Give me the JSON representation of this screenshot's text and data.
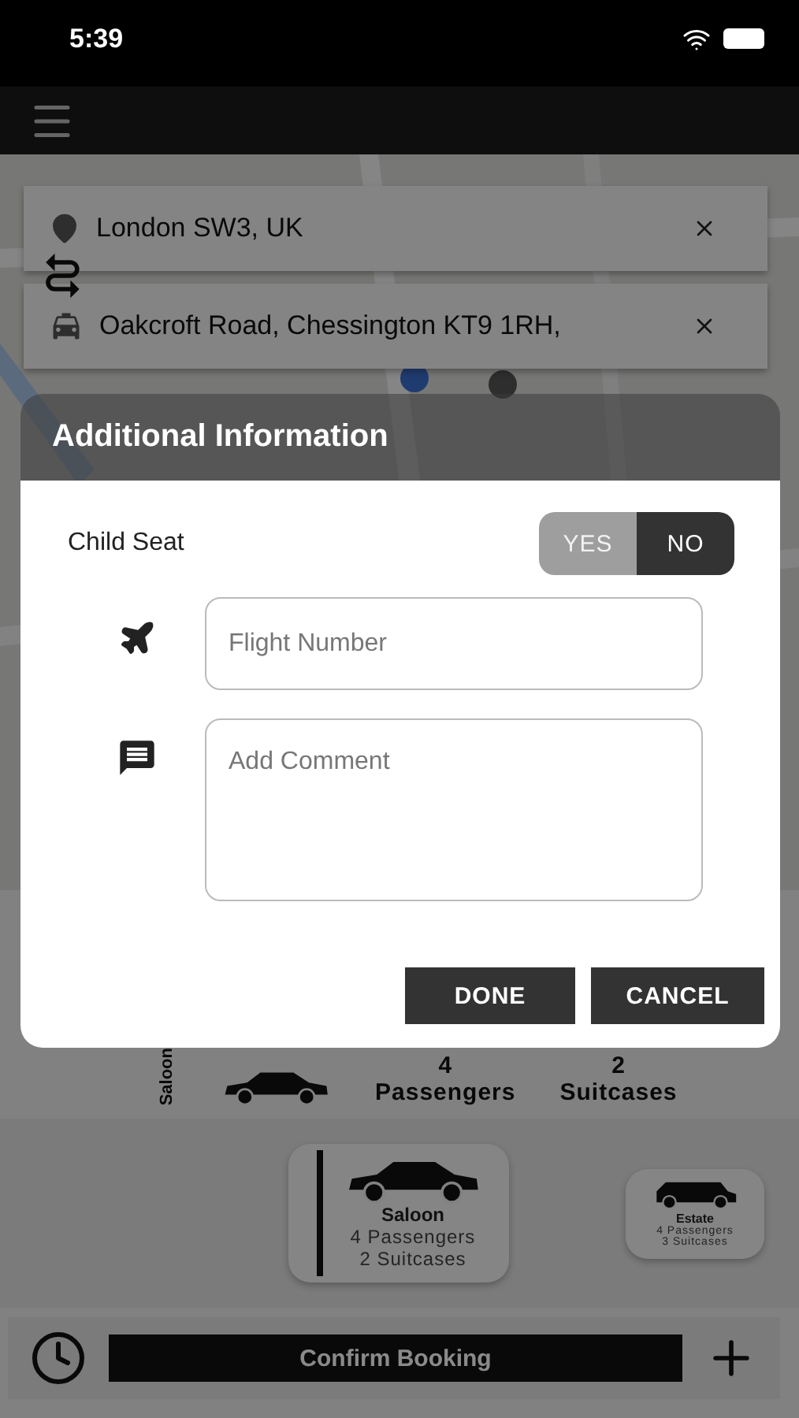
{
  "status_bar": {
    "time": "5:39"
  },
  "locations": [
    {
      "kind": "pickup",
      "text": "London SW3, UK"
    },
    {
      "kind": "dropoff",
      "text": "Oakcroft Road, Chessington KT9 1RH,"
    }
  ],
  "selected_vehicle": {
    "name": "Saloon",
    "passengers_count": "4",
    "passengers_label": "Passengers",
    "suitcases_count": "2",
    "suitcases_label": "Suitcases"
  },
  "vehicles": [
    {
      "kind": "saloon",
      "name": "Saloon",
      "passengers": "4 Passengers",
      "suitcases": "2 Suitcases",
      "selected": true
    },
    {
      "kind": "estate",
      "name": "Estate",
      "passengers": "4 Passengers",
      "suitcases": "3 Suitcases",
      "selected": false
    }
  ],
  "bottom_bar": {
    "button": "Confirm Booking"
  },
  "dialog": {
    "title": "Additional Information",
    "child_seat": {
      "label": "Child Seat",
      "options": [
        {
          "label": "YES",
          "selected": false
        },
        {
          "label": "NO",
          "selected": true
        }
      ]
    },
    "flight": {
      "placeholder": "Flight Number"
    },
    "comment": {
      "placeholder": "Add Comment"
    },
    "buttons": [
      "DONE",
      "CANCEL"
    ]
  }
}
